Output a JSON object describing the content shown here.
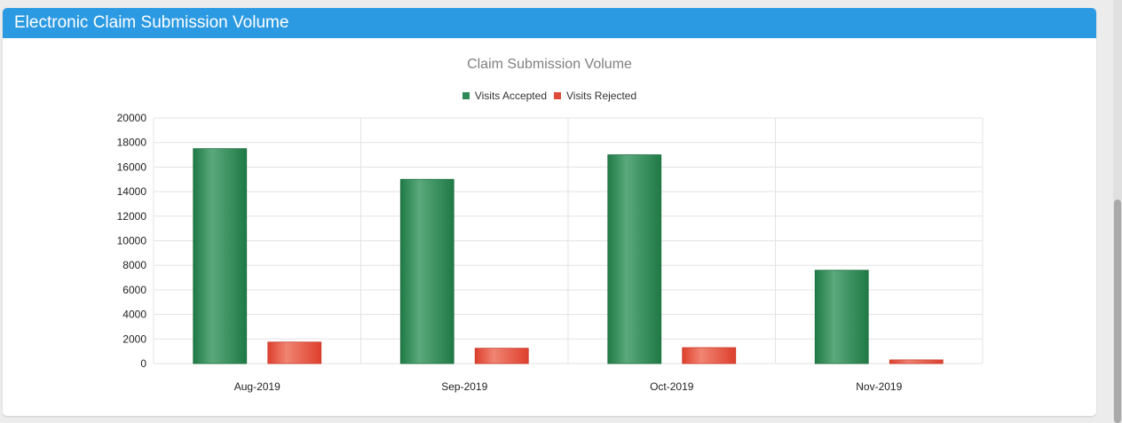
{
  "panel": {
    "title": "Electronic Claim Submission Volume"
  },
  "chart_data": {
    "type": "bar",
    "title": "Claim Submission Volume",
    "categories": [
      "Aug-2019",
      "Sep-2019",
      "Oct-2019",
      "Nov-2019"
    ],
    "series": [
      {
        "name": "Visits Accepted",
        "color": "#2e8b57",
        "values": [
          17500,
          15000,
          17000,
          7600
        ]
      },
      {
        "name": "Visits Rejected",
        "color": "#e04a3a",
        "values": [
          1750,
          1250,
          1300,
          300
        ]
      }
    ],
    "ylim": [
      0,
      20000
    ],
    "yticks": [
      "0",
      "2000",
      "4000",
      "6000",
      "8000",
      "10000",
      "12000",
      "14000",
      "16000",
      "18000",
      "20000"
    ],
    "xlabel": "",
    "ylabel": "",
    "grid": true,
    "legend": "top-center"
  }
}
